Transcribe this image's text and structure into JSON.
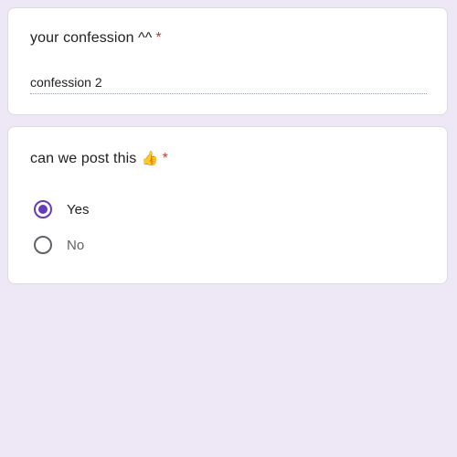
{
  "questions": [
    {
      "title": "your confession ^^",
      "required_mark": "*",
      "answer": "confession 2"
    },
    {
      "title": "can we post this",
      "icon": "thumbs-up-emoji",
      "required_mark": "*",
      "options": [
        {
          "label": "Yes",
          "selected": true
        },
        {
          "label": "No",
          "selected": false
        }
      ]
    }
  ],
  "colors": {
    "background": "#ede7f6",
    "accent": "#673ab7",
    "required": "#d93025"
  }
}
